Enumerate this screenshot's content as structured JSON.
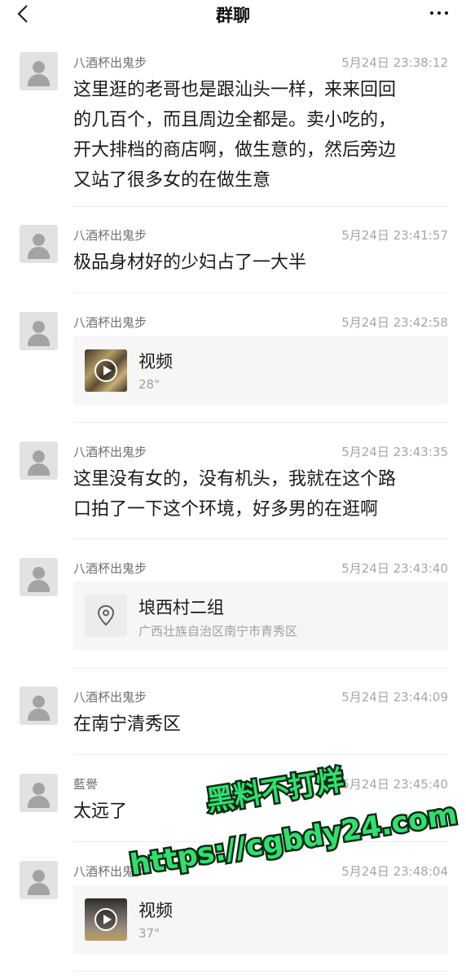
{
  "header": {
    "title": "群聊"
  },
  "messages": [
    {
      "sender": "八酒杯出鬼步",
      "time": "5月24日 23:38:12",
      "lines": [
        "这里逛的老哥也是跟汕头一样，来来回回",
        "的几百个，而且周边全都是。卖小吃的，",
        "开大排档的商店啊，做生意的，然后旁边",
        "又站了很多女的在做生意"
      ]
    },
    {
      "sender": "八酒杯出鬼步",
      "time": "5月24日 23:41:57",
      "lines": [
        "极品身材好的少妇占了一大半"
      ]
    },
    {
      "sender": "八酒杯出鬼步",
      "time": "5月24日 23:42:58",
      "video": {
        "label": "视频",
        "duration": "28\""
      }
    },
    {
      "sender": "八酒杯出鬼步",
      "time": "5月24日 23:43:35",
      "lines": [
        "这里没有女的，没有机头，我就在这个路",
        "口拍了一下这个环境，好多男的在逛啊"
      ]
    },
    {
      "sender": "八酒杯出鬼步",
      "time": "5月24日 23:43:40",
      "location": {
        "name": "埌西村二组",
        "address": "广西壮族自治区南宁市青秀区"
      }
    },
    {
      "sender": "八酒杯出鬼步",
      "time": "5月24日 23:44:09",
      "lines": [
        "在南宁清秀区"
      ]
    },
    {
      "sender": "藍譽",
      "time": "5月24日 23:45:40",
      "lines": [
        "太远了"
      ]
    },
    {
      "sender": "八酒杯出鬼步",
      "time": "5月24日 23:48:04",
      "video": {
        "label": "视频",
        "duration": "37\""
      }
    }
  ],
  "watermark": {
    "line1": "黑料不打烊",
    "line2": "https://cgbdy24.com",
    "color": "#2fe070"
  }
}
